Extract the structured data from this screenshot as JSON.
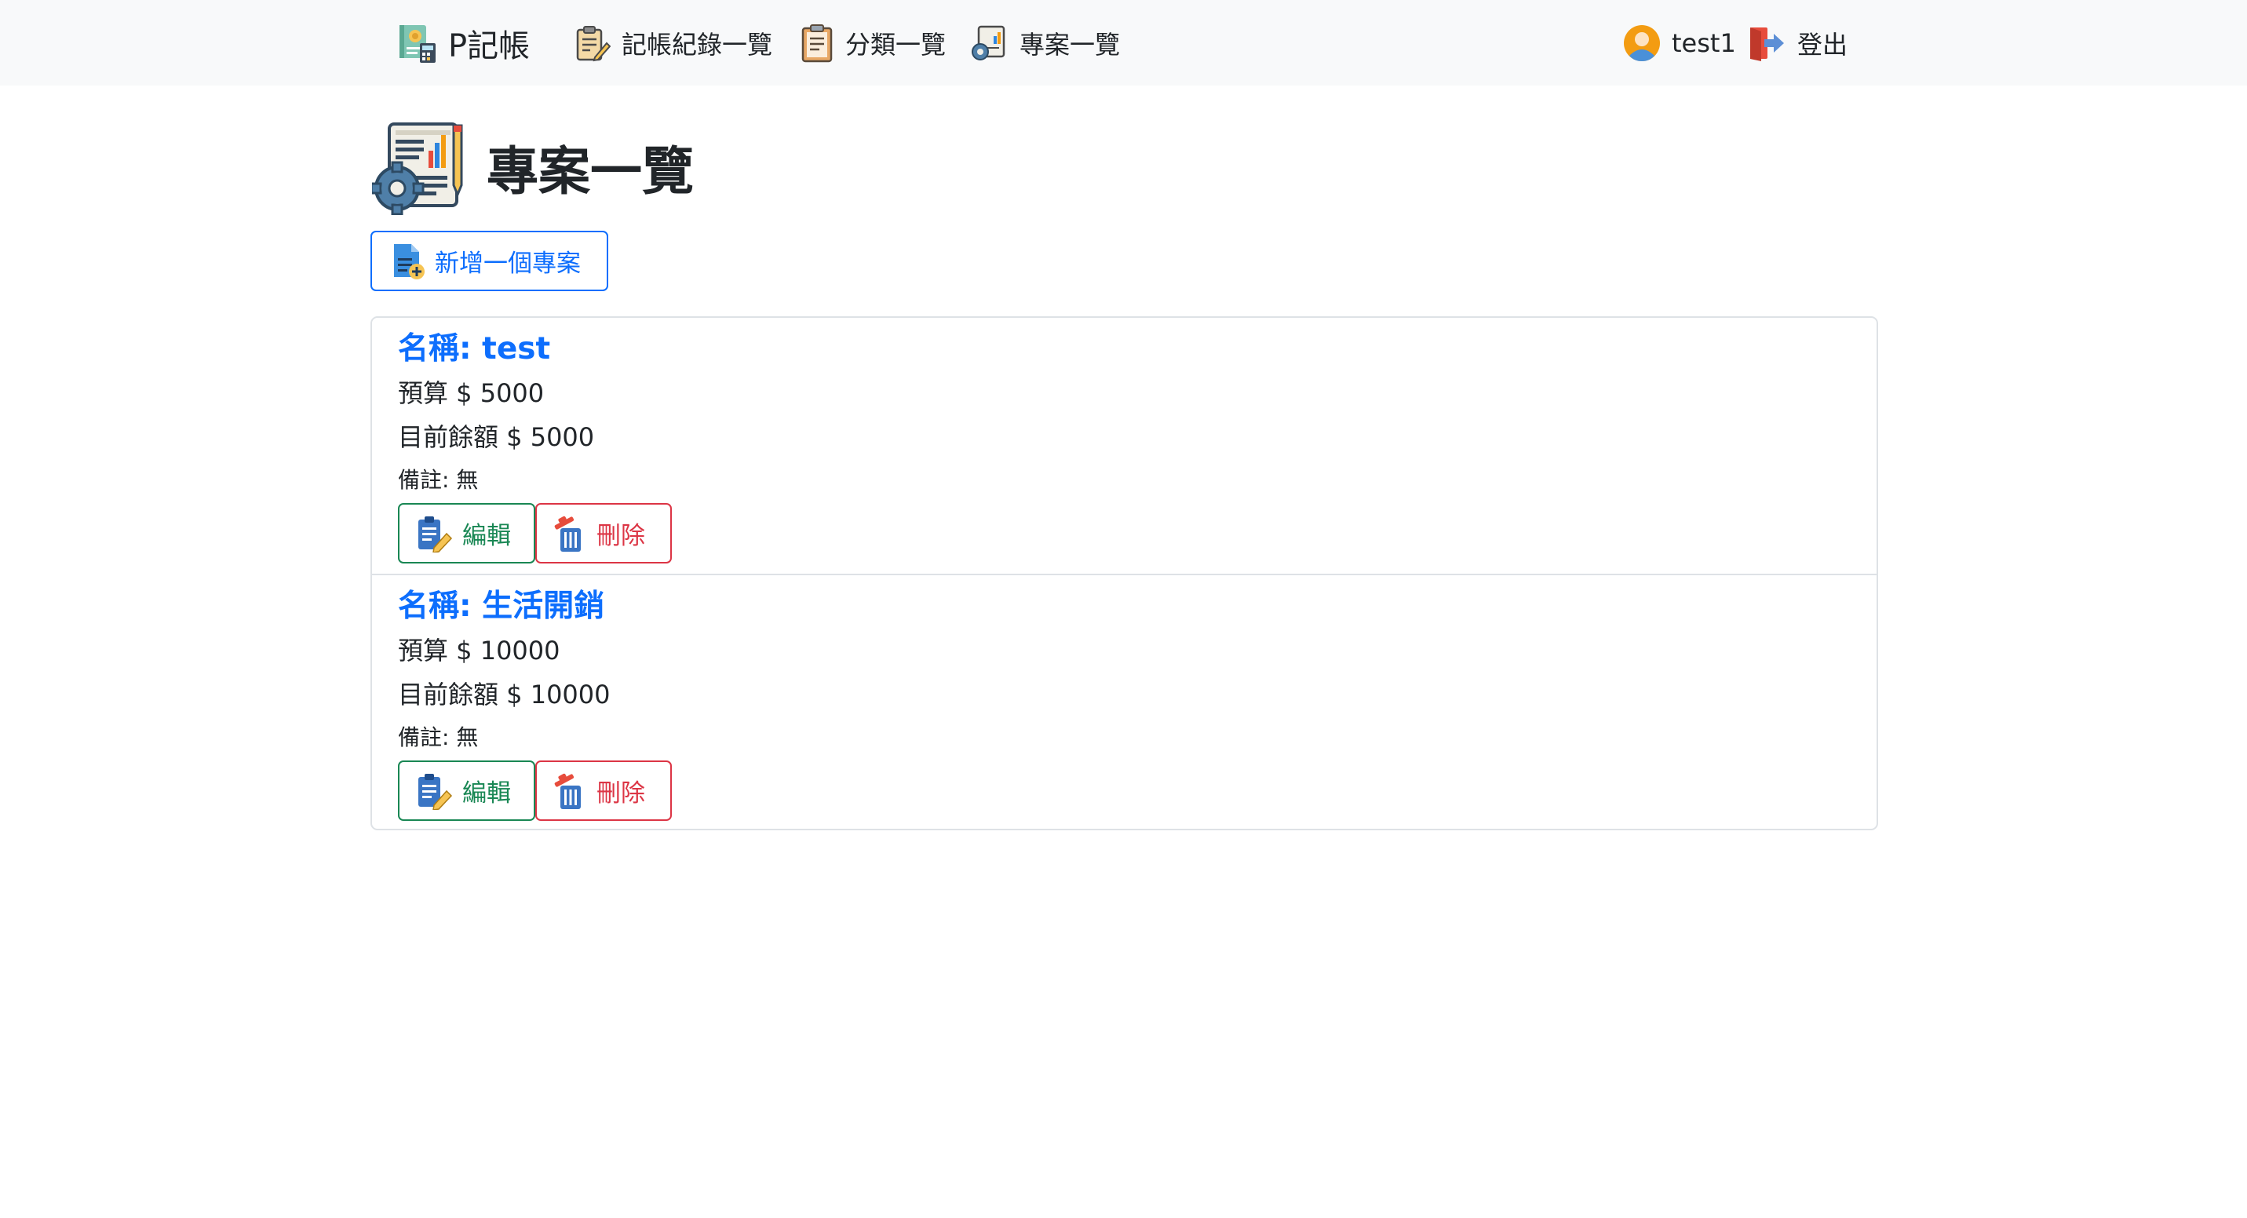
{
  "navbar": {
    "brand": {
      "label": "P記帳",
      "icon": "ledger-calculator-icon"
    },
    "links": [
      {
        "label": "記帳紀錄一覽",
        "icon": "clipboard-pen-icon"
      },
      {
        "label": "分類一覽",
        "icon": "clipboard-list-icon"
      },
      {
        "label": "專案一覽",
        "icon": "report-gear-icon"
      }
    ],
    "user": {
      "label": "test1",
      "icon": "user-avatar-icon"
    },
    "logout": {
      "label": "登出",
      "icon": "logout-door-icon"
    }
  },
  "page": {
    "title": "專案一覽",
    "title_icon": "report-chart-gear-icon",
    "add_button": {
      "label": "新增一個專案",
      "icon": "add-document-icon"
    }
  },
  "projects": [
    {
      "name": "名稱: test",
      "budget": "預算 $ 5000",
      "balance": "目前餘額 $ 5000",
      "note": "備註: 無",
      "edit_label": "編輯",
      "delete_label": "刪除"
    },
    {
      "name": "名稱: 生活開銷",
      "budget": "預算 $ 10000",
      "balance": "目前餘額 $ 10000",
      "note": "備註: 無",
      "edit_label": "編輯",
      "delete_label": "刪除"
    }
  ],
  "colors": {
    "primary": "#0d6efd",
    "success": "#198754",
    "danger": "#dc3545",
    "navbar_bg": "#f8f9fa",
    "border": "#dee2e6"
  }
}
